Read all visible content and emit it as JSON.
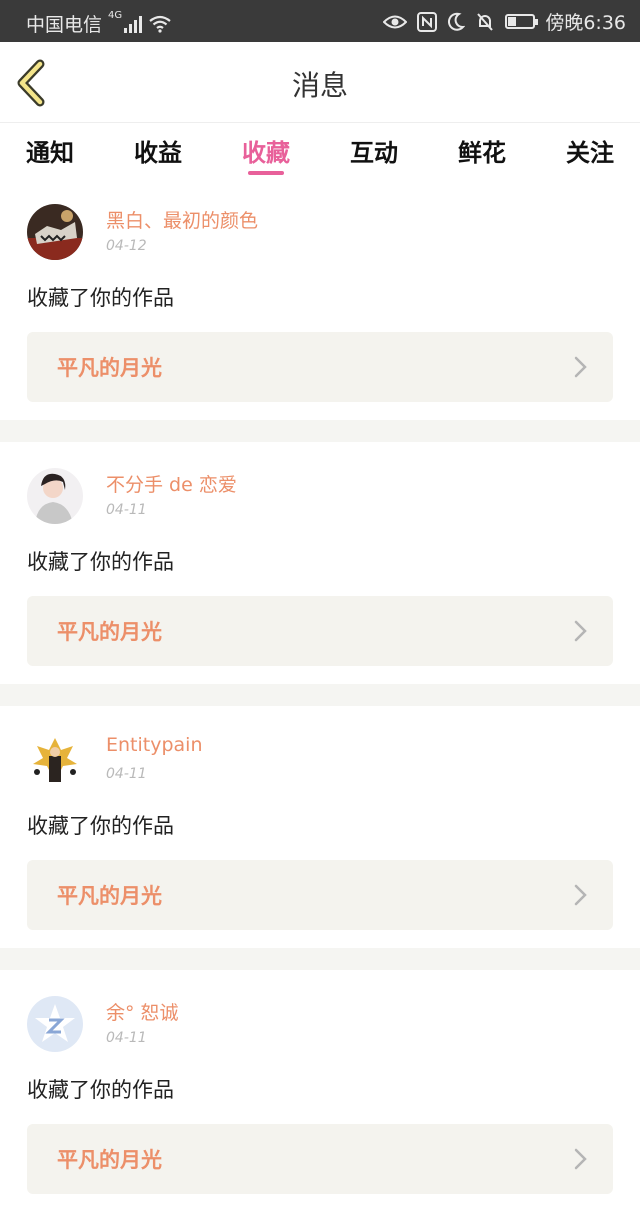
{
  "status_bar": {
    "carrier": "中国电信",
    "network": "4G",
    "time": "傍晚6:36",
    "battery_level": 0.3
  },
  "header": {
    "title": "消息",
    "back_icon": "back-chevron-icon"
  },
  "tabs": [
    {
      "label": "通知",
      "active": false
    },
    {
      "label": "收益",
      "active": false
    },
    {
      "label": "收藏",
      "active": true
    },
    {
      "label": "互动",
      "active": false
    },
    {
      "label": "鲜花",
      "active": false
    },
    {
      "label": "关注",
      "active": false
    }
  ],
  "colors": {
    "accent_pink": "#e8609a",
    "name_orange": "#ec8f69",
    "card_bg": "#f4f3ee"
  },
  "messages": [
    {
      "user": "黑白、最初的颜色",
      "date": "04-12",
      "action": "收藏了你的作品",
      "work_title": "平凡的月光"
    },
    {
      "user": "不分手 de 恋爱",
      "date": "04-11",
      "action": "收藏了你的作品",
      "work_title": "平凡的月光"
    },
    {
      "user": "Entitypain",
      "date": "04-11",
      "action": "收藏了你的作品",
      "work_title": "平凡的月光"
    },
    {
      "user": "余° 恕诚",
      "date": "04-11",
      "action": "收藏了你的作品",
      "work_title": "平凡的月光"
    }
  ]
}
